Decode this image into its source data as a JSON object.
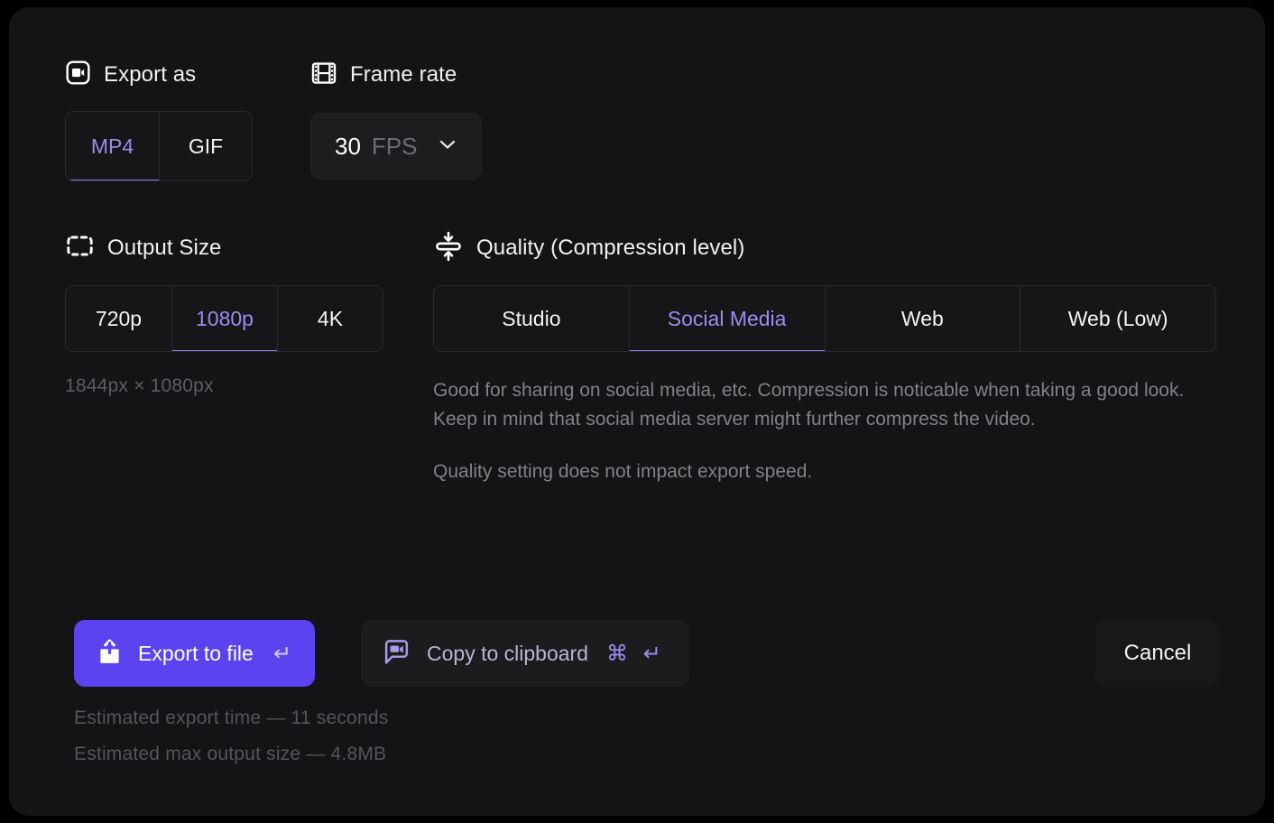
{
  "dialog": {
    "export_as": {
      "title": "Export as",
      "icon": "video-camera-icon",
      "options": [
        "MP4",
        "GIF"
      ],
      "selected": "MP4"
    },
    "frame_rate": {
      "title": "Frame rate",
      "icon": "film-strip-icon",
      "value": "30",
      "unit": "FPS"
    },
    "output_size": {
      "title": "Output Size",
      "icon": "dashed-rect-icon",
      "options": [
        "720p",
        "1080p",
        "4K"
      ],
      "selected": "1080p",
      "dimensions": "1844px × 1080px"
    },
    "quality": {
      "title": "Quality (Compression level)",
      "icon": "compress-icon",
      "options": [
        "Studio",
        "Social Media",
        "Web",
        "Web (Low)"
      ],
      "selected": "Social Media",
      "description": "Good for sharing on social media, etc. Compression is noticable when taking a good look. Keep in mind that social media server might further compress the video.",
      "note": "Quality setting does not impact export speed."
    },
    "actions": {
      "export_label": "Export to file",
      "export_shortcut": "↵",
      "export_icon": "upload-icon",
      "copy_label": "Copy to clipboard",
      "copy_shortcut": "⌘ ↵",
      "copy_icon": "video-chat-bubble-icon",
      "cancel_label": "Cancel"
    },
    "estimates": {
      "time": "Estimated export time — 11 seconds",
      "size": "Estimated max output size — 4.8MB"
    },
    "colors": {
      "accent": "#5B43F0",
      "accent_text": "#9a8cf0",
      "panel": "#141416"
    }
  }
}
